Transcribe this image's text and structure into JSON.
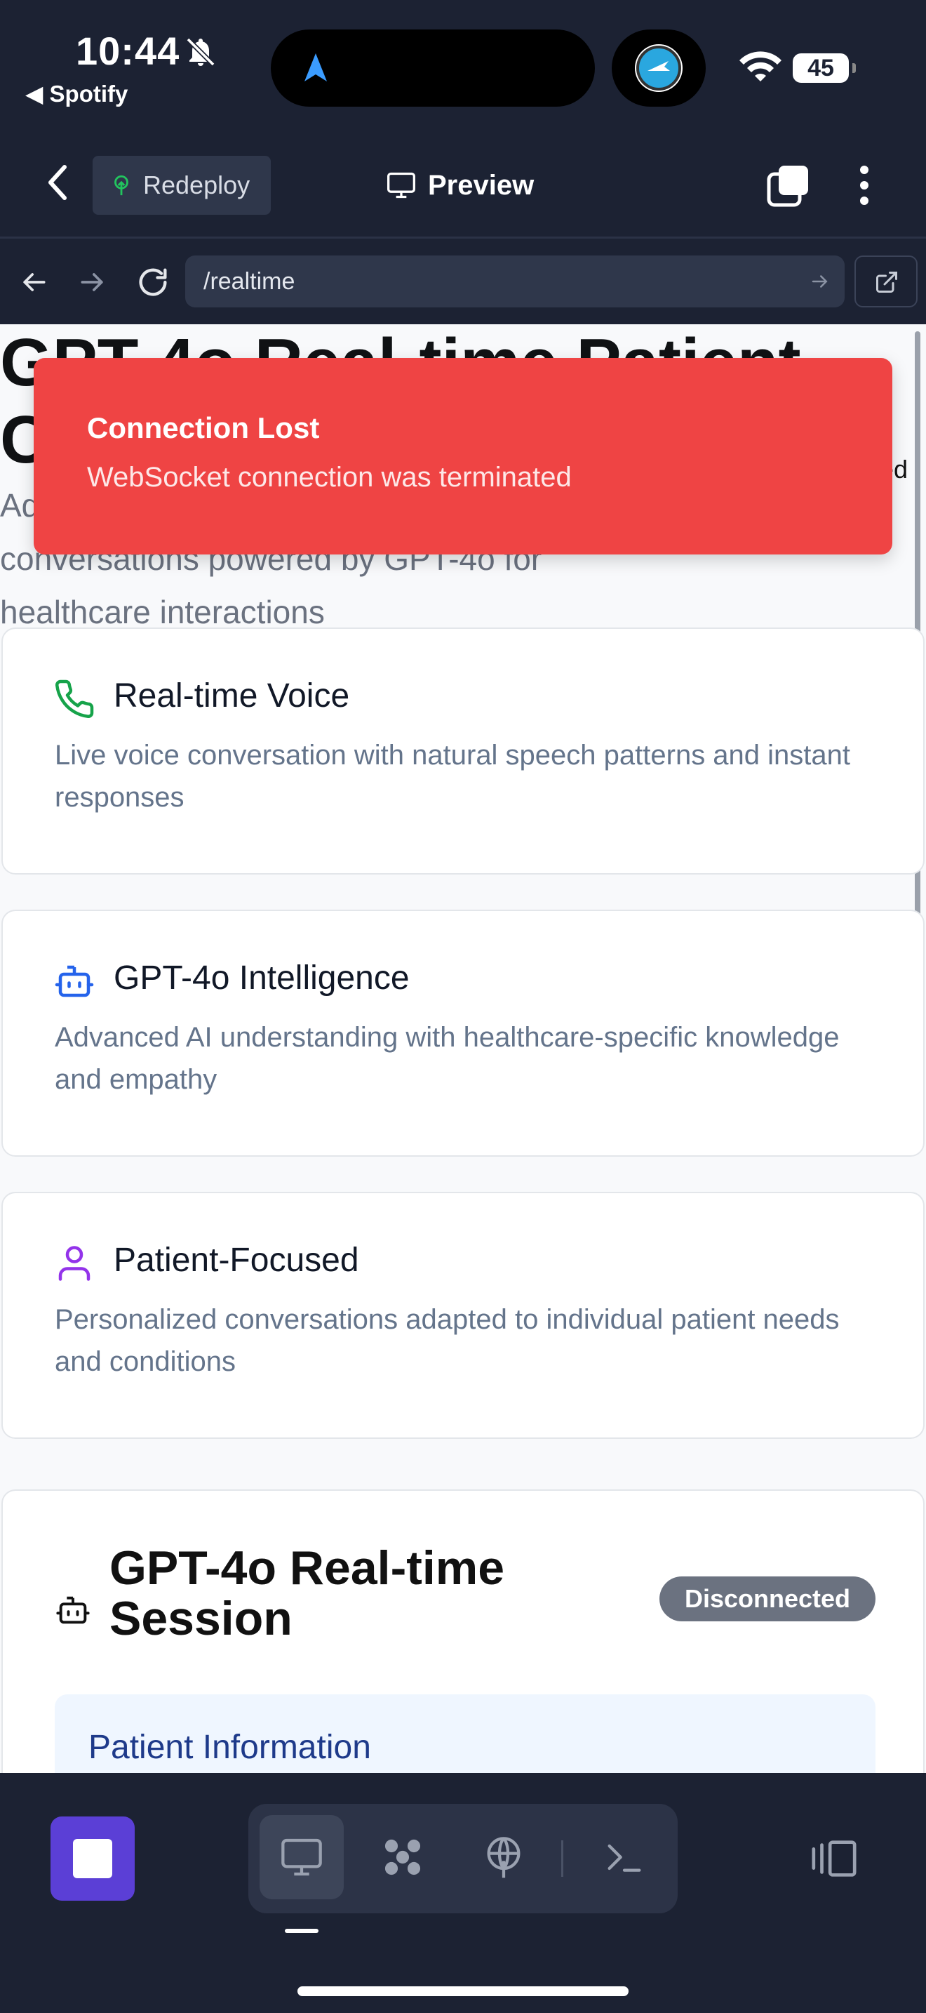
{
  "status_bar": {
    "time": "10:44",
    "back_app": "◀ Spotify",
    "battery": "45"
  },
  "header": {
    "redeploy_label": "Redeploy",
    "preview_label": "Preview"
  },
  "address_bar": {
    "url": "/realtime"
  },
  "hero": {
    "title": "GPT-4o Real-time Patient Conversations",
    "subtitle": "Advanced real-time voice conversations powered by GPT-4o for healthcare interactions",
    "badge_fragment": "ed"
  },
  "toast": {
    "title": "Connection Lost",
    "message": "WebSocket connection was terminated"
  },
  "features": [
    {
      "icon": "phone-icon",
      "title": "Real-time Voice",
      "description": "Live voice conversation with natural speech patterns and instant responses",
      "color": "#16a34a"
    },
    {
      "icon": "bot-icon",
      "title": "GPT-4o Intelligence",
      "description": "Advanced AI understanding with healthcare-specific knowledge and empathy",
      "color": "#2563eb"
    },
    {
      "icon": "user-icon",
      "title": "Patient-Focused",
      "description": "Personalized conversations adapted to individual patient needs and conditions",
      "color": "#9333ea"
    }
  ],
  "session": {
    "title": "GPT-4o Real-time Session",
    "status": "Disconnected",
    "patient_heading": "Patient Information"
  },
  "colors": {
    "toast_bg": "#ef4444",
    "stop_button": "#5b3fd6",
    "app_bg": "#1c2233",
    "badge_bg": "#6b7280"
  }
}
